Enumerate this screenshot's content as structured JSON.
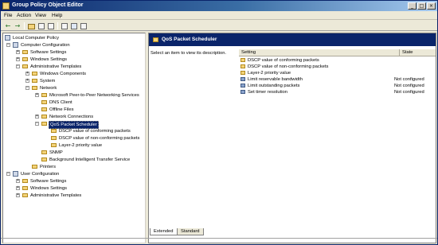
{
  "window": {
    "title": "Group Policy Object Editor",
    "buttons": {
      "minimize": "_",
      "maximize": "□",
      "close": "×"
    }
  },
  "menubar": [
    "File",
    "Action",
    "View",
    "Help"
  ],
  "toolbar": {
    "back": "←",
    "forward": "→"
  },
  "tree": {
    "root": "Local Computer Policy",
    "computer_configuration": "Computer Configuration",
    "software_settings": "Software Settings",
    "windows_settings": "Windows Settings",
    "administrative_templates": "Administrative Templates",
    "windows_components": "Windows Components",
    "system": "System",
    "network": "Network",
    "ms_peer": "Microsoft Peer-to-Peer Networking Services",
    "dns_client": "DNS Client",
    "offline_files": "Offline Files",
    "network_connections": "Network Connections",
    "qos": "QoS Packet Scheduler",
    "dscp_conforming": "DSCP value of conforming packets",
    "dscp_nonconforming": "DSCP value of non-conforming packets",
    "layer2": "Layer-2 priority value",
    "snmp": "SNMP",
    "bits": "Background Intelligent Transfer Service",
    "printers": "Printers",
    "user_configuration": "User Configuration",
    "user_software_settings": "Software Settings",
    "user_windows_settings": "Windows Settings",
    "user_administrative_templates": "Administrative Templates",
    "expanded_glyph": "−",
    "collapsed_glyph": "+"
  },
  "right": {
    "header_title": "QoS Packet Scheduler",
    "description": "Select an item to view its description.",
    "columns": {
      "setting": "Setting",
      "state": "State"
    },
    "rows": [
      {
        "name": "DSCP value of conforming packets",
        "state": "",
        "icon": "folder-icon"
      },
      {
        "name": "DSCP value of non-conforming packets",
        "state": "",
        "icon": "folder-icon"
      },
      {
        "name": "Layer-2 priority value",
        "state": "",
        "icon": "folder-icon"
      },
      {
        "name": "Limit reservable bandwidth",
        "state": "Not configured",
        "icon": "setting-icon"
      },
      {
        "name": "Limit outstanding packets",
        "state": "Not configured",
        "icon": "setting-icon"
      },
      {
        "name": "Set timer resolution",
        "state": "Not configured",
        "icon": "setting-icon"
      }
    ]
  },
  "tabs": {
    "extended": "Extended",
    "standard": "Standard"
  },
  "colors": {
    "selection": "#0a246a",
    "folder": "#f3d37a",
    "chrome": "#ece9d8"
  }
}
